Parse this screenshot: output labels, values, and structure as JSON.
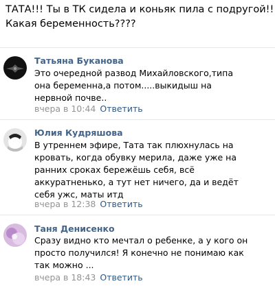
{
  "post": {
    "lines": [
      "ТАТА!!! Ты в ТК сидела и коньяк пила с подругой!!!",
      "Какая беременность????"
    ]
  },
  "comments": [
    {
      "author": "Татьяна Буканова",
      "lines": [
        "Это очередной развод Михайловского,типа",
        "она беременна,а потом.....выкидыш на",
        "нервной почве.."
      ],
      "date": "вчера в 10:44",
      "reply": "Ответить",
      "avatar_color": "#1a1a1a"
    },
    {
      "author": "Юлия Кудряшова",
      "lines": [
        "В утреннем эфире, Тата так плюхнулась на",
        "кровать, когда обувку мерила, даже уже на",
        "ранних сроках бережёшь себя, всё",
        "аккуратненько, а тут нет ничего, да и ведёт",
        "себя ужс, маты итд"
      ],
      "date": "вчера в 12:38",
      "reply": "Ответить",
      "avatar_color": "#d9d9d9"
    },
    {
      "author": "Таня Денисенко",
      "lines": [
        "Сразу видно кто мечтал о ребенке, а у кого он",
        "просто получился! Я конечно не понимаю как",
        "так можно ..."
      ],
      "date": "вчера в 18:43",
      "reply": "Ответить",
      "avatar_color": "#c9a3d6"
    }
  ]
}
